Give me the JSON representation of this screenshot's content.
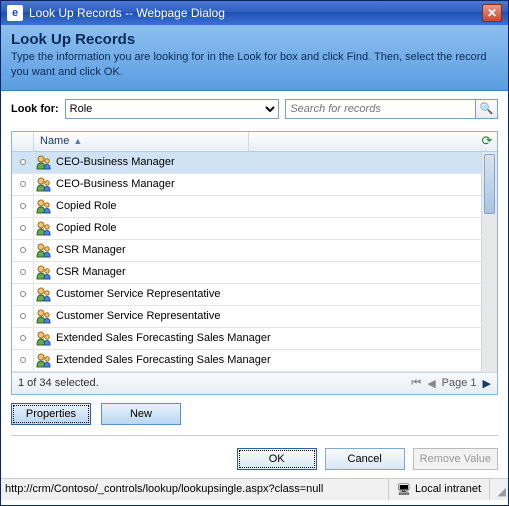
{
  "window": {
    "title": "Look Up Records -- Webpage Dialog"
  },
  "header": {
    "title": "Look Up Records",
    "instructions": "Type the information you are looking for in the Look for box and click Find. Then, select the record you want and click OK."
  },
  "lookfor": {
    "label": "Look for:",
    "selected": "Role"
  },
  "search": {
    "placeholder": "Search for records"
  },
  "grid": {
    "columns": {
      "name": "Name"
    },
    "rows": [
      {
        "name": "CEO-Business Manager",
        "selected": true
      },
      {
        "name": "CEO-Business Manager",
        "selected": false
      },
      {
        "name": "Copied Role",
        "selected": false
      },
      {
        "name": "Copied Role",
        "selected": false
      },
      {
        "name": "CSR Manager",
        "selected": false
      },
      {
        "name": "CSR Manager",
        "selected": false
      },
      {
        "name": "Customer Service Representative",
        "selected": false
      },
      {
        "name": "Customer Service Representative",
        "selected": false
      },
      {
        "name": "Extended Sales Forecasting Sales Manager",
        "selected": false
      },
      {
        "name": "Extended Sales Forecasting Sales Manager",
        "selected": false
      }
    ],
    "status": "1 of 34 selected.",
    "pager": {
      "label": "Page 1"
    }
  },
  "actions": {
    "properties": "Properties",
    "new": "New"
  },
  "dialog": {
    "ok": "OK",
    "cancel": "Cancel",
    "remove": "Remove Value"
  },
  "statusbar": {
    "url": "http://crm/Contoso/_controls/lookup/lookupsingle.aspx?class=null",
    "zone": "Local intranet"
  },
  "colors": {
    "accent": "#3c72d1",
    "selection": "#cfe3f5"
  }
}
